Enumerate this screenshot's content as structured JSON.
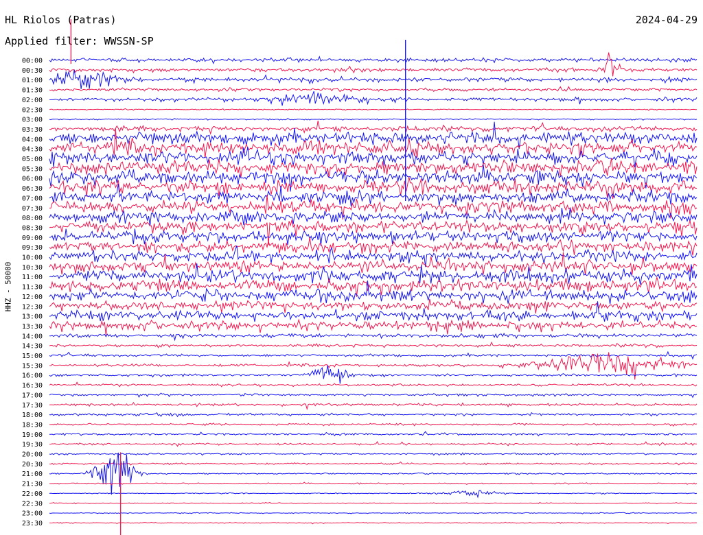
{
  "header": {
    "station": "HL Riolos (Patras)",
    "date": "2024-04-29",
    "filter": "Applied filter: WWSSN-SP"
  },
  "axis": {
    "ylabel": "HHZ - 50000"
  },
  "colors": {
    "series_a": "#1515f0",
    "series_b": "#f0174e",
    "background": "#ffffff"
  },
  "chart_data": {
    "type": "line",
    "title": "HL Riolos (Patras)",
    "subtitle": "Applied filter: WWSSN-SP",
    "date": "2024-04-29",
    "xlabel": "",
    "ylabel": "HHZ - 50000",
    "row_minutes": 30,
    "time_labels": [
      "00:00",
      "00:30",
      "01:00",
      "01:30",
      "02:00",
      "02:30",
      "03:00",
      "03:30",
      "04:00",
      "04:30",
      "05:00",
      "05:30",
      "06:00",
      "06:30",
      "07:00",
      "07:30",
      "08:00",
      "08:30",
      "09:00",
      "09:30",
      "10:00",
      "10:30",
      "11:00",
      "11:30",
      "12:00",
      "12:30",
      "13:00",
      "13:30",
      "14:00",
      "14:30",
      "15:00",
      "15:30",
      "16:00",
      "16:30",
      "17:00",
      "17:30",
      "18:00",
      "18:30",
      "19:00",
      "19:30",
      "20:00",
      "20:30",
      "21:00",
      "21:30",
      "22:00",
      "22:30",
      "23:00",
      "23:30"
    ],
    "relative_noise_amplitude": [
      2.5,
      2.3,
      2.8,
      2.0,
      2.2,
      0.6,
      0.9,
      3.2,
      8.0,
      8.0,
      8.5,
      8.5,
      8.5,
      8.5,
      8.0,
      8.0,
      7.5,
      7.5,
      7.5,
      7.0,
      7.0,
      7.5,
      8.0,
      8.0,
      7.5,
      6.0,
      6.0,
      5.5,
      2.5,
      1.8,
      1.6,
      1.6,
      1.5,
      1.5,
      1.5,
      1.5,
      1.5,
      1.3,
      1.3,
      1.2,
      1.1,
      1.1,
      0.9,
      0.8,
      0.6,
      0.6,
      0.6,
      0.6
    ],
    "series": [
      {
        "color_key": "series_a",
        "rows": "even (00:00, 01:00, ...)"
      },
      {
        "color_key": "series_b",
        "rows": "odd (00:30, 01:30, ...)"
      }
    ],
    "events": [
      {
        "time": "00:30",
        "minute": 26,
        "amplitude": 28,
        "width_min": 0.4
      },
      {
        "time": "01:00",
        "minute": 0.5,
        "amplitude": 16,
        "width_min": 2.5
      },
      {
        "time": "02:00",
        "minute": 12,
        "amplitude": 9,
        "width_min": 3
      },
      {
        "time": "15:30",
        "minute": 26,
        "amplitude": 18,
        "width_min": 3
      },
      {
        "time": "16:00",
        "minute": 13,
        "amplitude": 16,
        "width_min": 0.8
      },
      {
        "time": "21:00",
        "minute": 3,
        "amplitude": 40,
        "width_min": 0.8
      },
      {
        "time": "22:00",
        "minute": 19.5,
        "amplitude": 5,
        "width_min": 1.2
      }
    ]
  }
}
